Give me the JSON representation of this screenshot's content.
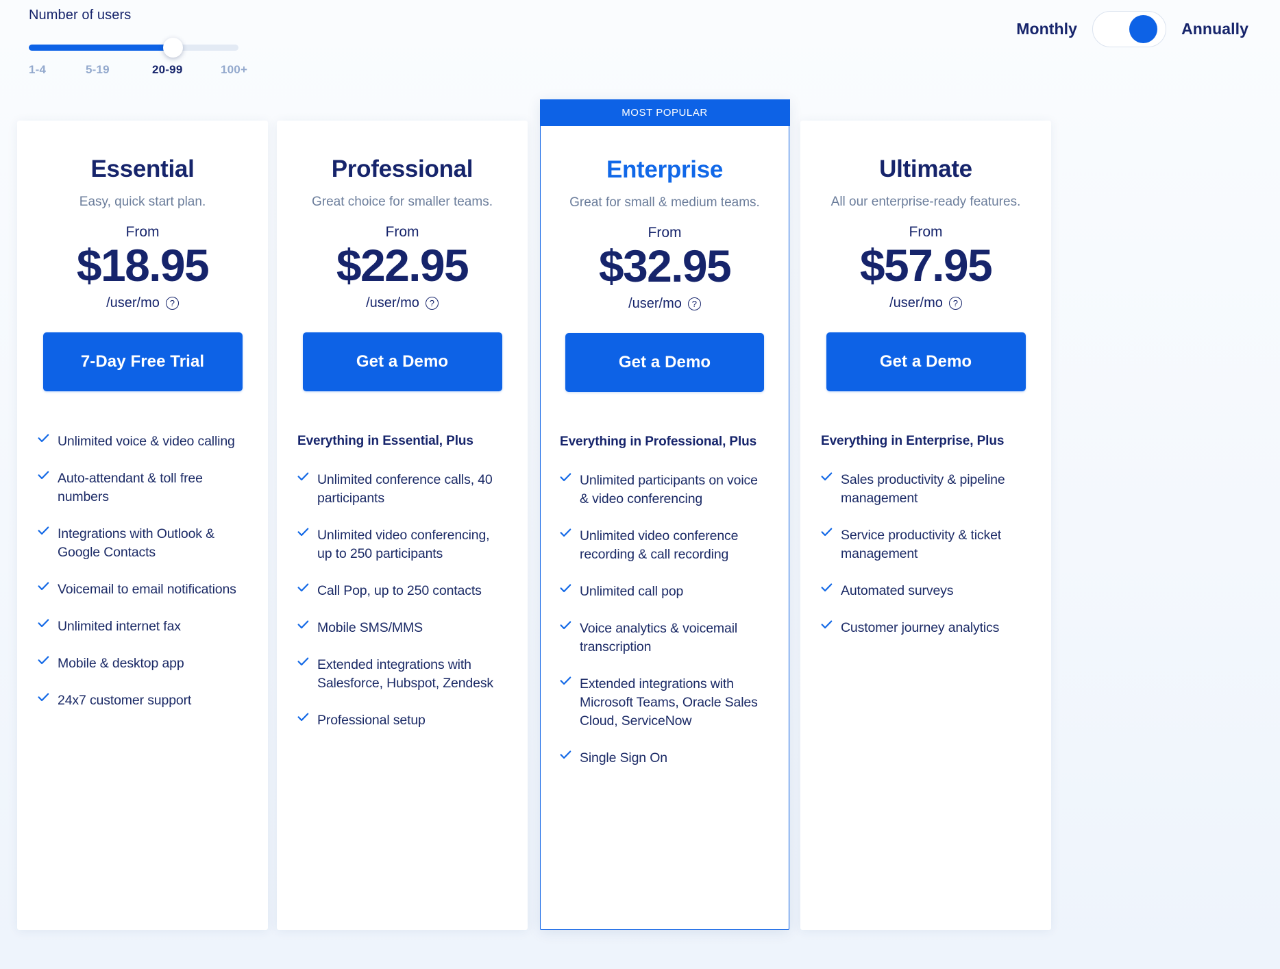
{
  "controls": {
    "users_label": "Number of users",
    "slider": {
      "value_label": "20-99",
      "ticks": [
        "1-4",
        "5-19",
        "20-99",
        "100+"
      ],
      "selected_index": 2
    },
    "billing": {
      "left_label": "Monthly",
      "right_label": "Annually",
      "selected": "Annually"
    }
  },
  "colors": {
    "accent_blue": "#0d62e6",
    "deep_navy": "#16246b",
    "muted_text": "#6b7d9b",
    "page_bg": "#f4f8fd"
  },
  "badge": {
    "most_popular": "MOST POPULAR"
  },
  "common": {
    "from_label": "From",
    "per_unit": "/user/mo",
    "info_glyph": "?"
  },
  "plans": [
    {
      "name": "Essential",
      "tagline": "Easy, quick start plan.",
      "from_label": "From",
      "price": "$18.95",
      "per_unit": "/user/mo",
      "cta": "7-Day Free Trial",
      "most_popular": false,
      "features_heading": "",
      "features": [
        "Unlimited voice & video calling",
        "Auto-attendant & toll free numbers",
        "Integrations with Outlook & Google Contacts",
        "Voicemail to email notifications",
        "Unlimited internet fax",
        "Mobile & desktop app",
        "24x7 customer support"
      ]
    },
    {
      "name": "Professional",
      "tagline": "Great choice for smaller teams.",
      "from_label": "From",
      "price": "$22.95",
      "per_unit": "/user/mo",
      "cta": "Get a Demo",
      "most_popular": false,
      "features_heading": "Everything in Essential, Plus",
      "features": [
        "Unlimited conference calls, 40 participants",
        "Unlimited video conferencing, up to 250 participants",
        "Call Pop, up to 250 contacts",
        "Mobile SMS/MMS",
        "Extended integrations with Salesforce, Hubspot, Zendesk",
        "Professional setup"
      ]
    },
    {
      "name": "Enterprise",
      "tagline": "Great for small & medium teams.",
      "from_label": "From",
      "price": "$32.95",
      "per_unit": "/user/mo",
      "cta": "Get a Demo",
      "most_popular": true,
      "features_heading": "Everything in Professional, Plus",
      "features": [
        "Unlimited participants on voice & video conferencing",
        "Unlimited video conference recording & call recording",
        "Unlimited call pop",
        "Voice analytics & voicemail transcription",
        "Extended integrations with Microsoft Teams, Oracle Sales Cloud, ServiceNow",
        "Single Sign On"
      ]
    },
    {
      "name": "Ultimate",
      "tagline": "All our enterprise-ready features.",
      "from_label": "From",
      "price": "$57.95",
      "per_unit": "/user/mo",
      "cta": "Get a Demo",
      "most_popular": false,
      "features_heading": "Everything in Enterprise, Plus",
      "features": [
        "Sales productivity & pipeline management",
        "Service productivity & ticket management",
        "Automated surveys",
        "Customer journey analytics"
      ]
    }
  ]
}
